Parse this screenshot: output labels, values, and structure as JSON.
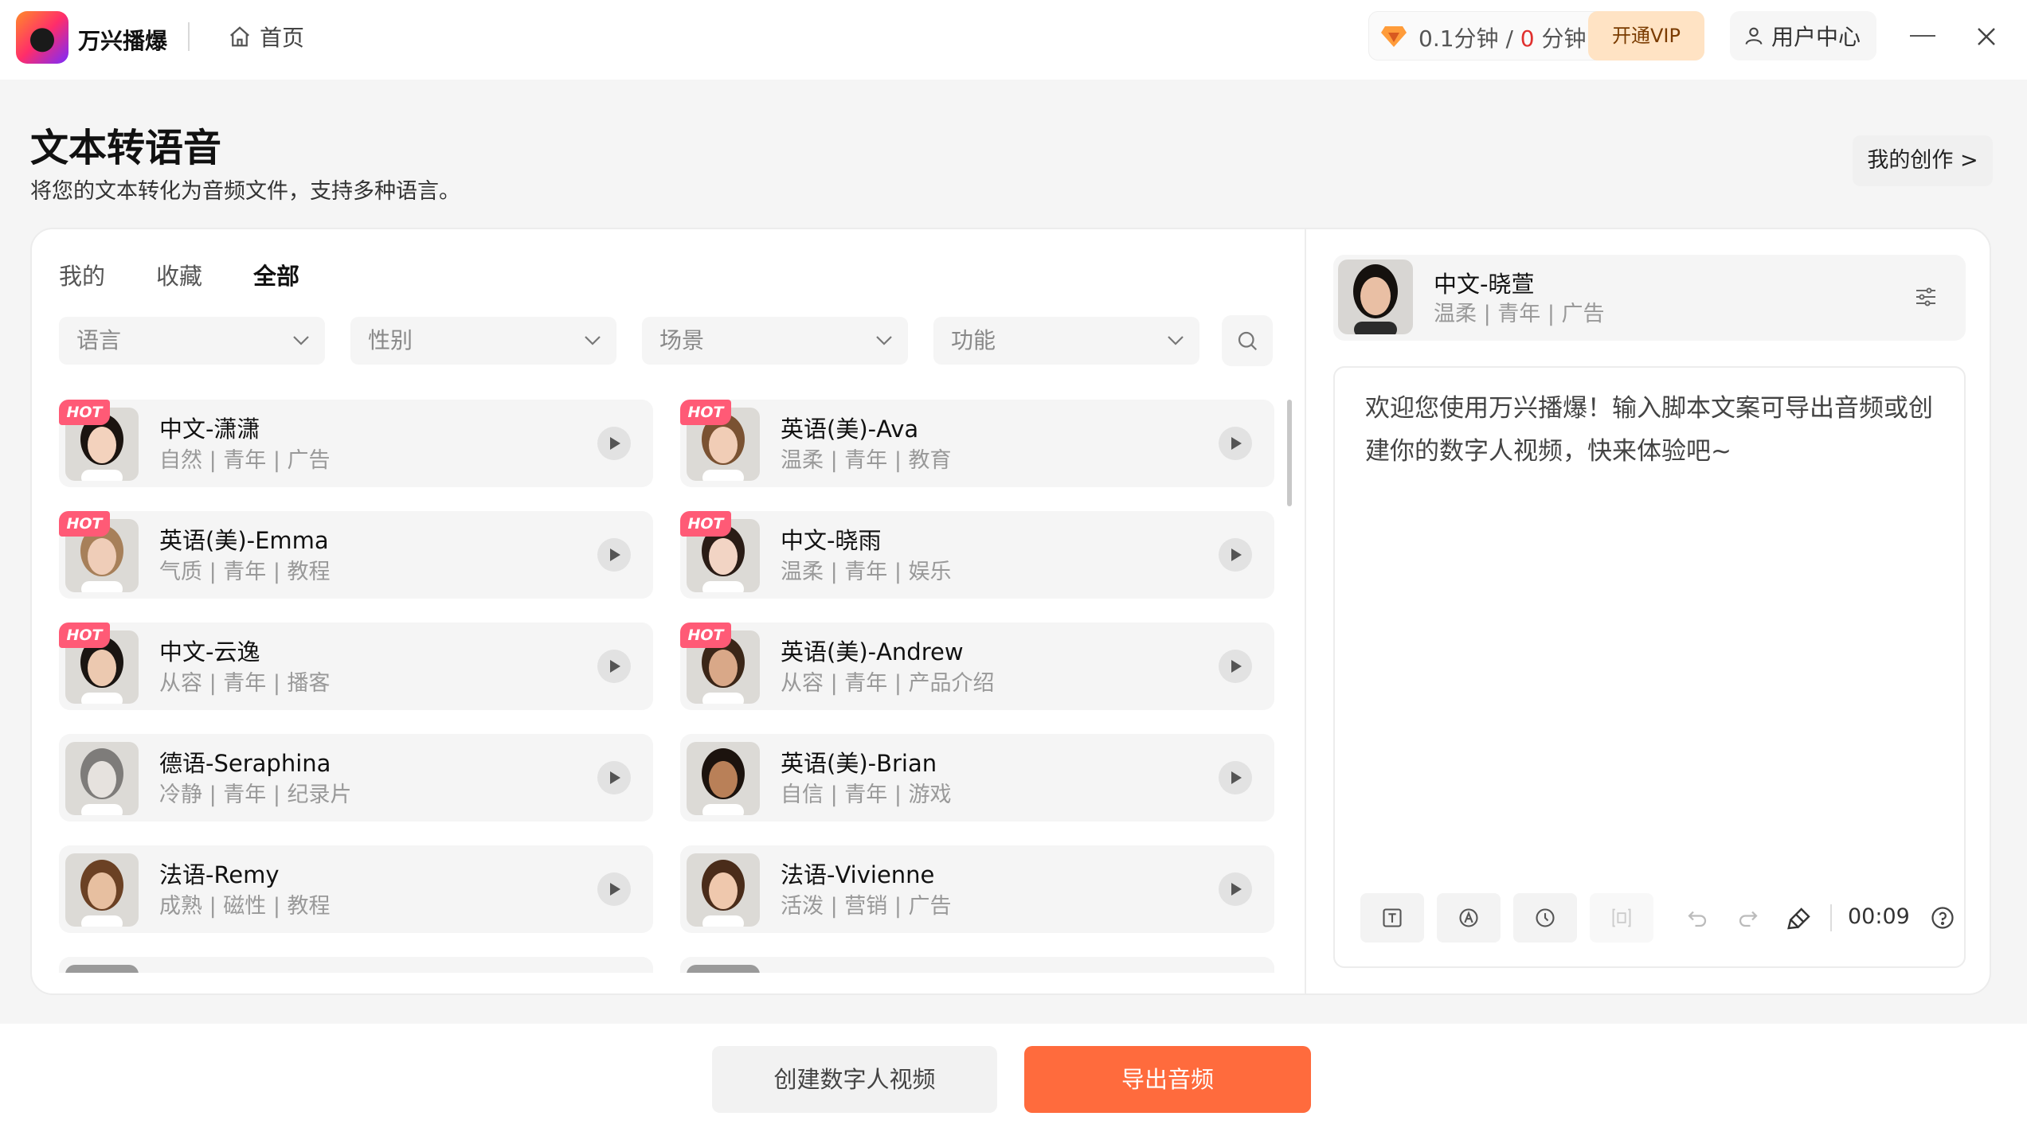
{
  "app": {
    "name": "万兴播爆",
    "home_label": "首页"
  },
  "account": {
    "minutes_used": "0.1分钟",
    "separator": "/",
    "minutes_total_number": "0",
    "minutes_total_unit": "分钟",
    "vip_label": "开通VIP",
    "user_center_label": "用户中心"
  },
  "page": {
    "title": "文本转语音",
    "subtitle": "将您的文本转化为音频文件，支持多种语言。",
    "my_creation_label": "我的创作 >"
  },
  "tabs": [
    {
      "label": "我的",
      "active": false
    },
    {
      "label": "收藏",
      "active": false
    },
    {
      "label": "全部",
      "active": true
    }
  ],
  "filters": [
    {
      "placeholder": "语言"
    },
    {
      "placeholder": "性别"
    },
    {
      "placeholder": "场景"
    },
    {
      "placeholder": "功能"
    }
  ],
  "voices": [
    {
      "name": "中文-潇潇",
      "tags": "自然 | 青年 | 广告",
      "hot": true,
      "hot_label": "HOT",
      "skin": "#f3d2bd",
      "hair": "#1b1410"
    },
    {
      "name": "英语(美)-Ava",
      "tags": "温柔 | 青年 | 教育",
      "hot": true,
      "hot_label": "HOT",
      "skin": "#f1cdb6",
      "hair": "#7a5232"
    },
    {
      "name": "英语(美)-Emma",
      "tags": "气质 | 青年 | 教程",
      "hot": true,
      "hot_label": "HOT",
      "skin": "#efcdb8",
      "hair": "#a7805a"
    },
    {
      "name": "中文-晓雨",
      "tags": "温柔 | 青年 | 娱乐",
      "hot": true,
      "hot_label": "HOT",
      "skin": "#f2d4c4",
      "hair": "#2a1c16"
    },
    {
      "name": "中文-云逸",
      "tags": "从容 | 青年 | 播客",
      "hot": true,
      "hot_label": "HOT",
      "skin": "#ecc9b0",
      "hair": "#1a1512"
    },
    {
      "name": "英语(美)-Andrew",
      "tags": "从容 | 青年 | 产品介绍",
      "hot": true,
      "hot_label": "HOT",
      "skin": "#d9a888",
      "hair": "#3b2618"
    },
    {
      "name": "德语-Seraphina",
      "tags": "冷静 | 青年 | 纪录片",
      "hot": false,
      "hot_label": "",
      "skin": "#e6e2de",
      "hair": "#7e7c7a"
    },
    {
      "name": "英语(美)-Brian",
      "tags": "自信 | 青年 | 游戏",
      "hot": false,
      "hot_label": "",
      "skin": "#b98058",
      "hair": "#1c130e"
    },
    {
      "name": "法语-Remy",
      "tags": "成熟 | 磁性 | 教程",
      "hot": false,
      "hot_label": "",
      "skin": "#e7bfa0",
      "hair": "#6b4124"
    },
    {
      "name": "法语-Vivienne",
      "tags": "活泼 | 营销 | 广告",
      "hot": false,
      "hot_label": "",
      "skin": "#efc8ad",
      "hair": "#4a2c1a"
    }
  ],
  "current_voice": {
    "name": "中文-晓萱",
    "tags": "温柔 | 青年 | 广告",
    "skin": "#e9bfa4",
    "hair": "#15110e"
  },
  "editor": {
    "text": "欢迎您使用万兴播爆！输入脚本文案可导出音频或创建你的数字人视频，快来体验吧~",
    "duration": "00:09",
    "tool_icons": [
      "text-icon",
      "pronunciation-icon",
      "pause-icon",
      "paragraph-icon",
      "undo-icon",
      "redo-icon",
      "clear-icon",
      "help-icon"
    ]
  },
  "actions": {
    "create_video_label": "创建数字人视频",
    "export_audio_label": "导出音频"
  },
  "colors": {
    "accent": "#ff6b3d",
    "hot_badge": "#ff5a76",
    "vip_bg": "#ffe3c4",
    "quota_zero": "#e0302e"
  }
}
